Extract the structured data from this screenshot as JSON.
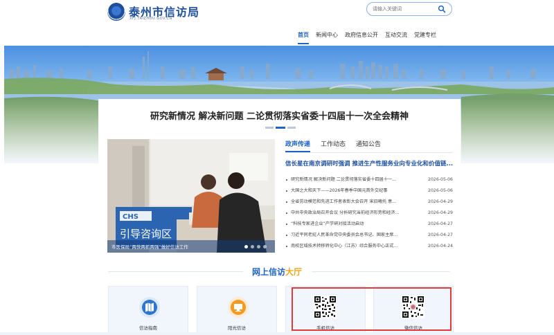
{
  "header": {
    "site_title": "泰州市信访局",
    "site_url": "XFJ.TAIZHOU.GOV.CN",
    "search": {
      "placeholder": "请输入关键词"
    }
  },
  "nav": [
    {
      "label": "首页",
      "active": true
    },
    {
      "label": "新闻中心",
      "active": false
    },
    {
      "label": "政府信息公开",
      "active": false
    },
    {
      "label": "互动交流",
      "active": false
    },
    {
      "label": "党建专栏",
      "active": false
    }
  ],
  "headline": "研究新情况 解决新问题 二论贯彻落实省委十四届十一次全会精神",
  "photo": {
    "caption": "市医保局“两快两抓两强”做好信访工作",
    "sign_text": "CHS",
    "slide_count": 4,
    "active_slide": 1
  },
  "tabs": [
    {
      "label": "政声传递",
      "active": true
    },
    {
      "label": "工作动态",
      "active": false
    },
    {
      "label": "通知公告",
      "active": false
    }
  ],
  "lead_story": "信长星在南京调研时强调 推进生产性服务业向专业化和价值链...",
  "news": [
    {
      "title": "研究新情况 解决新问题 二论贯彻落实省委十四届十一...",
      "date": "2026-05-06"
    },
    {
      "title": "大国之大和天下——2026年春季中国元首外交纪事",
      "date": "2026-05-06"
    },
    {
      "title": "全省劳动模范和先进工作者表彰大会召开 宋旧曦托 意...",
      "date": "2026-04-29"
    },
    {
      "title": "中共中央政治局召开会议 分析研究当前经济形势和经济...",
      "date": "2026-04-29"
    },
    {
      "title": "“科技专家进企业”产学研对接活动启动",
      "date": "2026-04-27"
    },
    {
      "title": "习近平同老挝人民革命党中央委员会总书记、国家主席...",
      "date": "2026-04-27"
    },
    {
      "title": "南校区域技术转移转化中心（江苏）综合服务中心正式...",
      "date": "2026-04-24"
    }
  ],
  "hall": {
    "title_a": "网上信访",
    "title_b": "大厅"
  },
  "tiles": [
    {
      "label": "信访指南",
      "icon": "map-icon"
    },
    {
      "label": "阳光信访",
      "icon": "monitor-icon"
    },
    {
      "label": "手机信访",
      "icon": "qr-code-icon"
    },
    {
      "label": "微信信访",
      "icon": "qr-code-icon"
    }
  ],
  "colors": {
    "brand_blue": "#1f63c6",
    "accent_orange": "#f0a61e",
    "highlight_red": "#e0393e"
  }
}
